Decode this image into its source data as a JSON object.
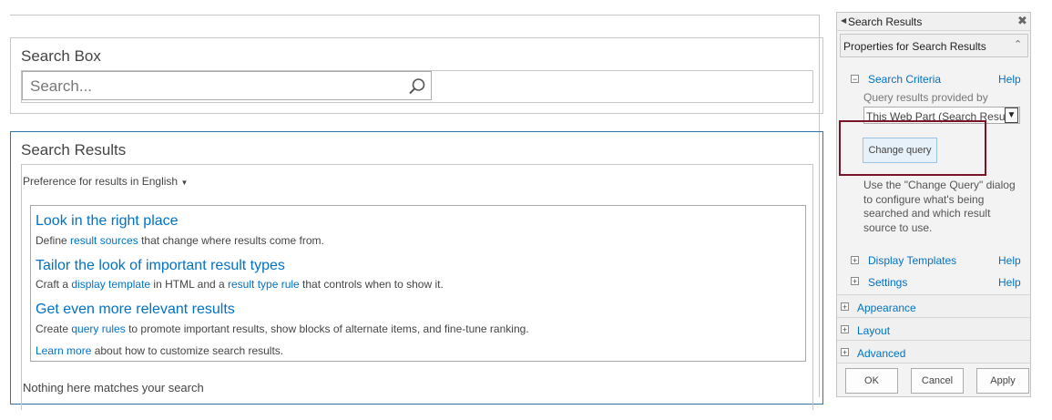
{
  "search_box": {
    "title": "Search Box",
    "placeholder": "Search..."
  },
  "search_results": {
    "title": "Search Results",
    "preference_prefix": "Preference for results in",
    "preference_language": "English",
    "tips": [
      {
        "title": "Look in the right place",
        "desc_before": "Define ",
        "desc_link": "result sources",
        "desc_after": " that change where results come from."
      },
      {
        "title": "Tailor the look of important result types",
        "desc_before": "Craft a ",
        "desc_link": "display template",
        "desc_middle": " in HTML and a ",
        "desc_link2": "result type rule",
        "desc_after": " that controls when to show it."
      },
      {
        "title": "Get even more relevant results",
        "desc_before": "Create ",
        "desc_link": "query rules",
        "desc_after": " to promote important results, show blocks of alternate items, and fine-tune ranking."
      }
    ],
    "learn_more_link": "Learn more",
    "learn_more_text": " about how to customize search results.",
    "no_results": "Nothing here matches your search"
  },
  "tool_pane": {
    "title": "Search Results",
    "properties_label": "Properties for Search Results",
    "search_criteria": {
      "label": "Search Criteria",
      "help": "Help",
      "query_label": "Query results provided by",
      "query_value": "This Web Part (Search Results",
      "change_query_button": "Change query",
      "description": "Use the \"Change Query\" dialog to configure what's being searched and which result source to use."
    },
    "display_templates": {
      "label": "Display Templates",
      "help": "Help"
    },
    "settings": {
      "label": "Settings",
      "help": "Help"
    },
    "sections": [
      "Appearance",
      "Layout",
      "Advanced"
    ],
    "buttons": {
      "ok": "OK",
      "cancel": "Cancel",
      "apply": "Apply"
    },
    "highlight_color": "#7a1426"
  }
}
